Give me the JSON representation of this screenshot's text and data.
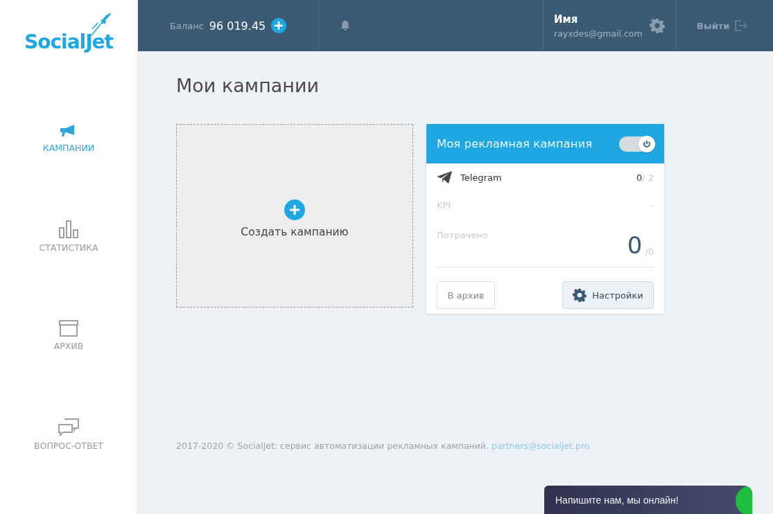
{
  "logo": "SocialJet",
  "header": {
    "balance_label": "Баланс",
    "balance": "96 019.45",
    "user_name": "Имя",
    "user_email": "rayxdes@gmail.com",
    "logout": "Выйти"
  },
  "sidebar": {
    "items": [
      {
        "label": "КАМПАНИИ",
        "kind": "megaphone",
        "selected": true
      },
      {
        "label": "СТАТИСТИКА",
        "kind": "chart",
        "selected": false
      },
      {
        "label": "АРХИВ",
        "kind": "box",
        "selected": false
      },
      {
        "label": "ВОПРОС-ОТВЕТ",
        "kind": "chat",
        "selected": false
      }
    ]
  },
  "page_title": "Мои кампании",
  "create_card": {
    "label": "Создать кампанию"
  },
  "campaign": {
    "title": "Моя рекламная кампания",
    "on": true,
    "channel": "Telegram",
    "channel_count": "0",
    "channel_total": "/ 2",
    "kpi_label": "KPI",
    "kpi_value": "-",
    "spent_label": "Потрачено",
    "spent_value": "0",
    "spent_total": "/0",
    "archive_button": "В архив",
    "settings_button": "Настройки"
  },
  "footer": {
    "text": "2017-2020 © SocialJet: сервис автоматизации рекламных кампаний.",
    "link": "partners@socialjet.pro"
  },
  "chat_widget": {
    "text": "Напишите нам, мы онлайн!"
  }
}
